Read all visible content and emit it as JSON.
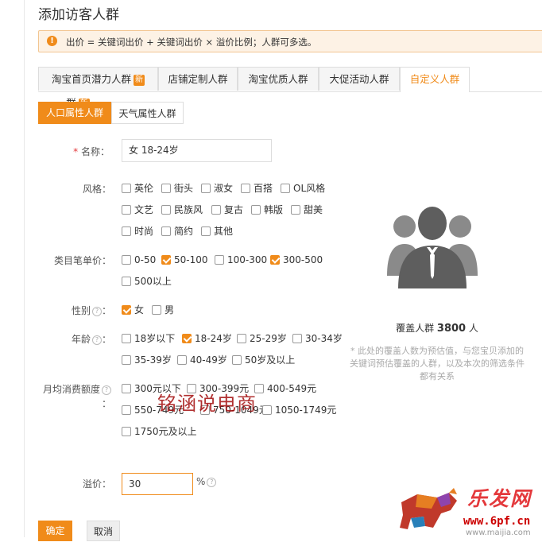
{
  "page_title": "添加访客人群",
  "alert": {
    "text": "出价 = 关键词出价 + 关键词出价 × 溢价比例；人群可多选。"
  },
  "tabs": [
    {
      "label": "淘宝首页潜力人群",
      "badge": "新"
    },
    {
      "label": "店铺定制人群"
    },
    {
      "label": "淘宝优质人群"
    },
    {
      "label": "大促活动人群"
    },
    {
      "label": "自定义人群",
      "active": true
    }
  ],
  "subtabs": [
    {
      "label": "人口属性人群",
      "active": true
    },
    {
      "label": "天气属性人群"
    }
  ],
  "name_field": {
    "label": "名称：",
    "required_mark": "*",
    "value": "女  18-24岁"
  },
  "style": {
    "label": "风格：",
    "options": [
      {
        "label": "英伦",
        "checked": false
      },
      {
        "label": "街头",
        "checked": false
      },
      {
        "label": "淑女",
        "checked": false
      },
      {
        "label": "百搭",
        "checked": false
      },
      {
        "label": "OL风格",
        "checked": false
      },
      {
        "label": "文艺",
        "checked": false
      },
      {
        "label": "民族风",
        "checked": false
      },
      {
        "label": "复古",
        "checked": false
      },
      {
        "label": "韩版",
        "checked": false
      },
      {
        "label": "甜美",
        "checked": false
      },
      {
        "label": "时尚",
        "checked": false
      },
      {
        "label": "简约",
        "checked": false
      },
      {
        "label": "其他",
        "checked": false
      }
    ]
  },
  "price": {
    "label": "类目笔单价：",
    "options": [
      {
        "label": "0-50",
        "checked": false
      },
      {
        "label": "50-100",
        "checked": true
      },
      {
        "label": "100-300",
        "checked": false
      },
      {
        "label": "300-500",
        "checked": true
      },
      {
        "label": "500以上",
        "checked": false
      }
    ]
  },
  "gender": {
    "label": "性别",
    "options": [
      {
        "label": "女",
        "checked": true
      },
      {
        "label": "男",
        "checked": false
      }
    ]
  },
  "age": {
    "label": "年龄",
    "options": [
      {
        "label": "18岁以下",
        "checked": false
      },
      {
        "label": "18-24岁",
        "checked": true
      },
      {
        "label": "25-29岁",
        "checked": false
      },
      {
        "label": "30-34岁",
        "checked": false
      },
      {
        "label": "35-39岁",
        "checked": false
      },
      {
        "label": "40-49岁",
        "checked": false
      },
      {
        "label": "50岁及以上",
        "checked": false
      }
    ]
  },
  "spend": {
    "label": "月均消费额度",
    "label2": "：",
    "options": [
      {
        "label": "300元以下",
        "checked": false
      },
      {
        "label": "300-399元",
        "checked": false
      },
      {
        "label": "400-549元",
        "checked": false
      },
      {
        "label": "550-749元",
        "checked": false
      },
      {
        "label": "750-1049元",
        "checked": false
      },
      {
        "label": "1050-1749元",
        "checked": false
      },
      {
        "label": "1750元及以上",
        "checked": false
      }
    ]
  },
  "premium": {
    "label": "溢价：",
    "value": "30",
    "unit": "%"
  },
  "coverage": {
    "prefix": "覆盖人群",
    "count": "3800",
    "suffix": "人"
  },
  "note": "* 此处的覆盖人数为预估值，与您宝贝添加的关键词预估覆盖的人群，以及本次的筛选条件都有关系",
  "watermark": "铭涵说电商",
  "buttons": {
    "confirm": "确定",
    "cancel": "取消"
  },
  "brand": {
    "name": "乐发网",
    "url": "www.6pf.cn",
    "url2": "www.maijia.com"
  },
  "colors": {
    "accent": "#f08b1a",
    "alert_bg": "#fdf2e5"
  }
}
